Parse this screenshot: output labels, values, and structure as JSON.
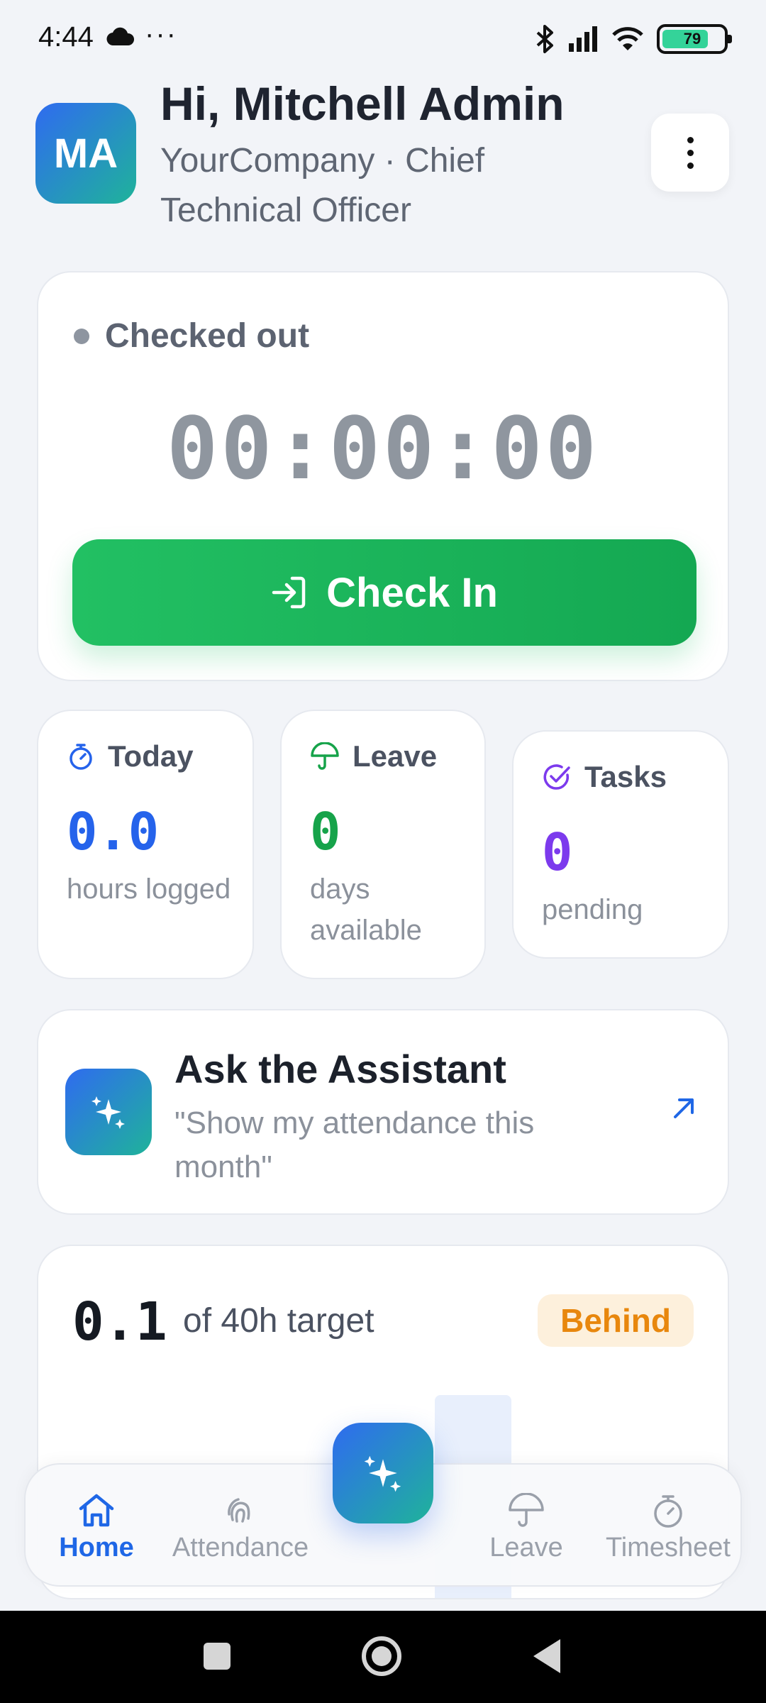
{
  "status_bar": {
    "time": "4:44",
    "more": "···",
    "battery": "79"
  },
  "header": {
    "avatar_initials": "MA",
    "greeting": "Hi, Mitchell Admin",
    "subtitle": "YourCompany · Chief Technical Officer",
    "menu_icon": "more-vertical-icon"
  },
  "attendance": {
    "status": "Checked out",
    "timer": "00:00:00",
    "button_label": "Check In",
    "button_icon": "login-arrow-icon"
  },
  "stats": [
    {
      "label": "Today",
      "value": "0.0",
      "desc": "hours logged",
      "icon": "stopwatch-icon",
      "color": "#2563eb"
    },
    {
      "label": "Leave",
      "value": "0",
      "desc": "days available",
      "icon": "umbrella-icon",
      "color": "#16a34a"
    },
    {
      "label": "Tasks",
      "value": "0",
      "desc": "pending",
      "icon": "check-circle-icon",
      "color": "#7c3aed"
    }
  ],
  "assistant": {
    "title": "Ask the Assistant",
    "prompt": "\"Show my attendance this month\"",
    "icon": "sparkles-icon"
  },
  "weekly": {
    "value": "0.1",
    "label": "of 40h target",
    "badge": "Behind"
  },
  "nav": {
    "items": [
      {
        "label": "Home",
        "icon": "home-icon",
        "active": true
      },
      {
        "label": "Attendance",
        "icon": "fingerprint-icon",
        "active": false
      },
      {
        "label": "Leave",
        "icon": "umbrella-icon",
        "active": false
      },
      {
        "label": "Timesheet",
        "icon": "stopwatch-icon",
        "active": false
      }
    ],
    "fab_icon": "sparkles-icon"
  },
  "colors": {
    "accent": "#1f67e6",
    "checkin_green": "#1bb45a",
    "badge_orange": "#e8870d"
  }
}
